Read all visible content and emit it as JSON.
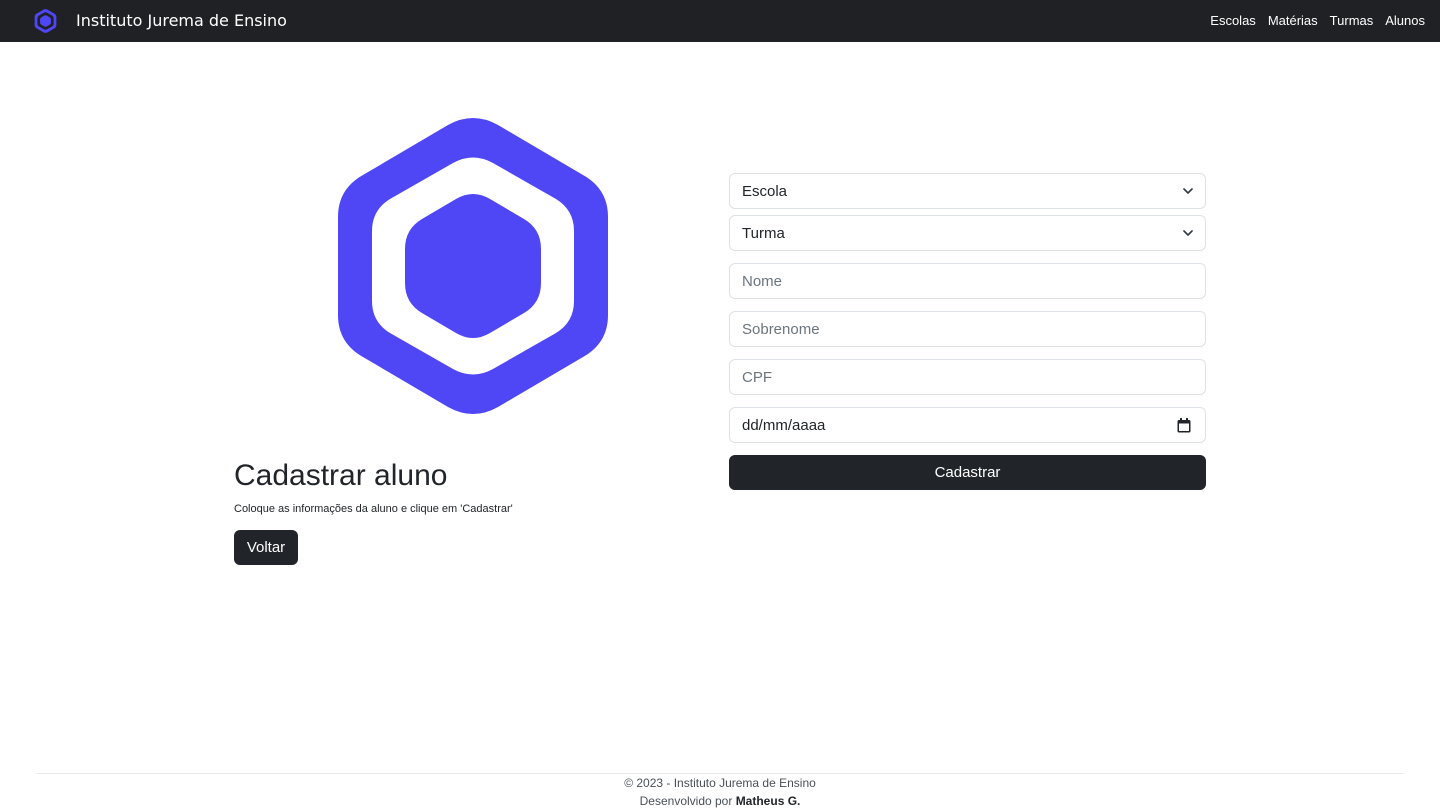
{
  "brand": {
    "name": "Instituto Jurema de Ensino",
    "accent_color": "#4f46f5",
    "nav_background": "#1f2125"
  },
  "nav": {
    "links": [
      "Escolas",
      "Matérias",
      "Turmas",
      "Alunos"
    ]
  },
  "hero": {
    "logo_icon": "hexagon-logo-icon",
    "title": "Cadastrar aluno",
    "subtitle": "Coloque as informações da aluno e clique em 'Cadastrar'",
    "back_button": "Voltar"
  },
  "form": {
    "school_select": {
      "selected": "Escola"
    },
    "class_select": {
      "selected": "Turma"
    },
    "first_name": {
      "placeholder": "Nome",
      "value": ""
    },
    "last_name": {
      "placeholder": "Sobrenome",
      "value": ""
    },
    "cpf": {
      "placeholder": "CPF",
      "value": ""
    },
    "birth_date": {
      "value": "dd/mm/aaaa"
    },
    "submit_button": "Cadastrar"
  },
  "footer": {
    "copyright": "© 2023 - Instituto Jurema de Ensino",
    "developed_by": "Desenvolvido por",
    "author": "Matheus G."
  }
}
